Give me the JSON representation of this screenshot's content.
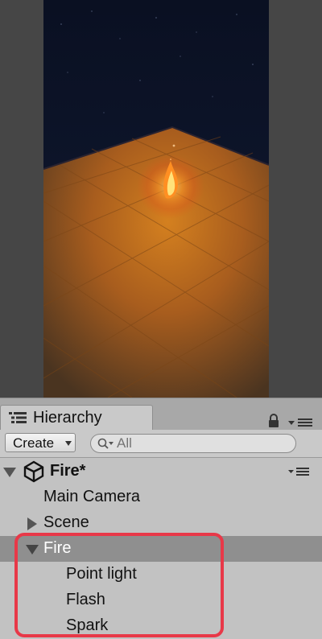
{
  "game_view": {
    "description_colors": {
      "sky": "#0b1226",
      "floor": "#b86a20",
      "flame": "#ff9a2a"
    }
  },
  "hierarchy": {
    "tab_label": "Hierarchy",
    "create_label": "Create",
    "search_placeholder": "All",
    "scene": {
      "name": "Fire*"
    },
    "items": [
      {
        "label": "Main Camera",
        "depth": 1,
        "expandable": false,
        "selected": false
      },
      {
        "label": "Scene",
        "depth": 1,
        "expandable": true,
        "expanded": false,
        "selected": false
      },
      {
        "label": "Fire",
        "depth": 1,
        "expandable": true,
        "expanded": true,
        "selected": true
      },
      {
        "label": "Point light",
        "depth": 2,
        "expandable": false,
        "selected": false
      },
      {
        "label": "Flash",
        "depth": 2,
        "expandable": false,
        "selected": false
      },
      {
        "label": "Spark",
        "depth": 2,
        "expandable": false,
        "selected": false
      }
    ],
    "highlight_color": "#e83848",
    "selected_color": "#8f8f8f"
  }
}
